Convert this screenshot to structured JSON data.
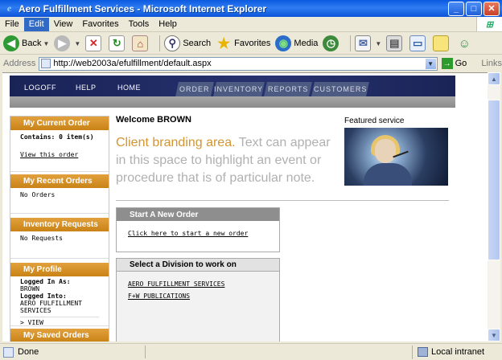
{
  "window": {
    "title": "Aero Fulfillment Services - Microsoft Internet Explorer",
    "controls": {
      "minimize": "_",
      "maximize": "□",
      "close": "✕"
    }
  },
  "menubar": {
    "items": [
      "File",
      "Edit",
      "View",
      "Favorites",
      "Tools",
      "Help"
    ],
    "active_index": 1
  },
  "toolbar": {
    "back": "Back",
    "search": "Search",
    "favorites": "Favorites",
    "media": "Media"
  },
  "addressbar": {
    "label": "Address",
    "url": "http://web2003a/efulfillment/default.aspx",
    "go": "Go",
    "links": "Links"
  },
  "app": {
    "topnav": {
      "logoff": "LOGOFF",
      "help": "HELP",
      "home": "HOME"
    },
    "tabs": [
      "ORDER",
      "INVENTORY",
      "REPORTS",
      "CUSTOMERS"
    ],
    "sidebar": {
      "current_order": {
        "title": "My Current Order",
        "contains": "Contains: 0 item(s)",
        "view_link": "View this order"
      },
      "recent_orders": {
        "title": "My Recent Orders",
        "text": "No Orders"
      },
      "inventory_requests": {
        "title": "Inventory Requests",
        "text": "No Requests"
      },
      "profile": {
        "title": "My Profile",
        "logged_in_as_label": "Logged In As:",
        "logged_in_as": "BROWN",
        "logged_into_label": "Logged Into:",
        "logged_into": "AERO FULFILLMENT SERVICES",
        "view_link": "> VIEW"
      },
      "saved_orders": {
        "title": "My Saved Orders"
      }
    },
    "welcome": "Welcome BROWN",
    "featured_label": "Featured service",
    "branding": {
      "highlight": "Client branding area.",
      "rest": " Text can appear in this space to highlight an event or procedure that is of particular note."
    },
    "new_order": {
      "title": "Start A New Order",
      "link": "Click here to start a new order"
    },
    "division": {
      "title": "Select a Division to work on",
      "options": [
        "AERO FULFILLMENT SERVICES",
        "F+W PUBLICATIONS"
      ]
    }
  },
  "statusbar": {
    "text": "Done",
    "zone": "Local intranet"
  },
  "colors": {
    "accent": "#d39530",
    "header": "#1a2356",
    "xp_title": "#0a5ae0"
  }
}
